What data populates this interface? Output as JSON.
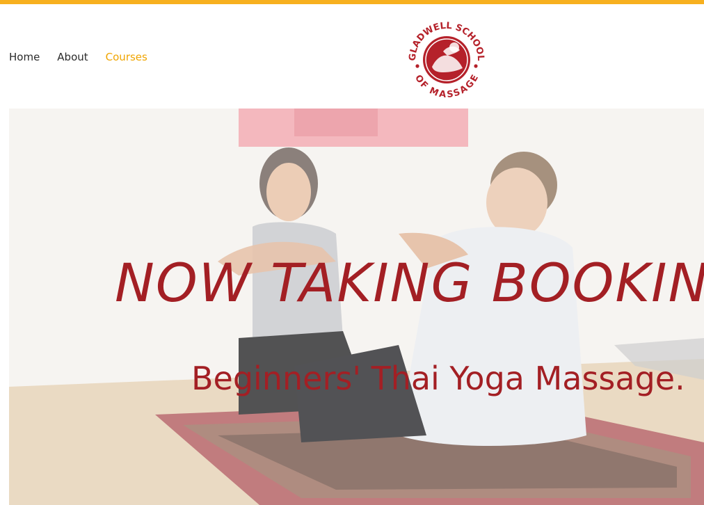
{
  "nav": {
    "items": [
      {
        "label": "Home",
        "active": false
      },
      {
        "label": "About",
        "active": false
      },
      {
        "label": "Courses",
        "active": true
      }
    ],
    "active_color": "#f0a500"
  },
  "logo": {
    "alt": "Gladwell School of Massage",
    "ring_text": "GLADWELL SCHOOL OF MASSAGE",
    "color": "#b5212a"
  },
  "hero": {
    "title": "NOW TAKING BOOKING",
    "subtitle": "Beginners' Thai Yoga Massage.",
    "text_color": "#a31f24"
  },
  "accent": "#f7b01f"
}
